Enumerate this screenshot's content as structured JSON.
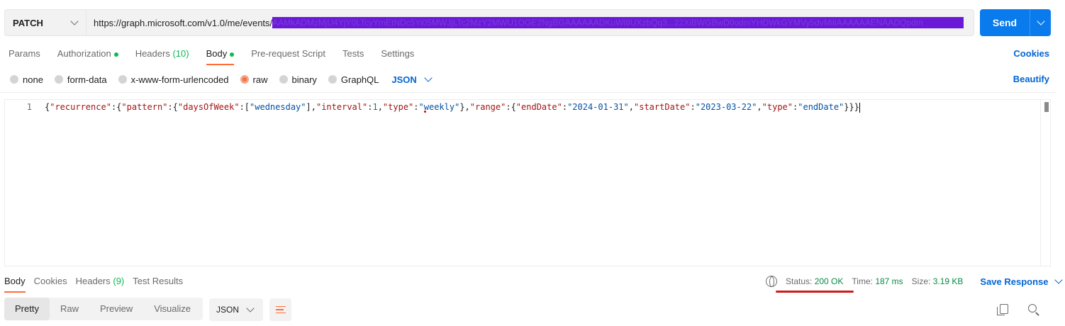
{
  "request": {
    "method": "PATCH",
    "url_base": "https://graph.microsoft.com/v1.0/me/events/",
    "url_redacted": "AAMkADMzMjU4YjY0LTcyYmEtNDc5Yi05MWJjLTc2MzY2MWU1OGE2NgBGAAAAAADKuWl8UXzbQq3...22XiBWGBwD0odmYHDWkGYMVy5dvMiliAAAAAAENAADQpdm",
    "send_label": "Send"
  },
  "request_tabs": {
    "params": "Params",
    "authorization": "Authorization",
    "headers_label": "Headers",
    "headers_count": "(10)",
    "body": "Body",
    "prerequest": "Pre-request Script",
    "tests": "Tests",
    "settings": "Settings",
    "cookies": "Cookies"
  },
  "body_types": {
    "none": "none",
    "form_data": "form-data",
    "urlencoded": "x-www-form-urlencoded",
    "raw": "raw",
    "binary": "binary",
    "graphql": "GraphQL",
    "format": "JSON",
    "beautify": "Beautify"
  },
  "editor": {
    "line_number": "1",
    "tokens": {
      "t1": "{",
      "t2": "\"recurrence\"",
      "t3": ":{",
      "t4": "\"pattern\"",
      "t5": ":{",
      "t6": "\"daysOfWeek\"",
      "t7": ":[",
      "t8": "\"wednesday\"",
      "t9": "],",
      "t10": "\"interval\"",
      "t11": ":",
      "t12": "1",
      "t13": ",",
      "t14": "\"type\"",
      "t15": ":",
      "t16": "\"weekly\"",
      "t17": "},",
      "t18": "\"range\"",
      "t19": ":{",
      "t20": "\"endDate\"",
      "t21": ":",
      "t22": "\"2024-01-31\"",
      "t23": ",",
      "t24": "\"startDate\"",
      "t25": ":",
      "t26": "\"2023-03-22\"",
      "t27": ",",
      "t28": "\"type\"",
      "t29": ":",
      "t30": "\"endDate\"",
      "t31": "}}}"
    }
  },
  "response_tabs": {
    "body": "Body",
    "cookies": "Cookies",
    "headers_label": "Headers",
    "headers_count": "(9)",
    "test_results": "Test Results"
  },
  "response_status": {
    "status_label": "Status:",
    "status_value": "200 OK",
    "time_label": "Time:",
    "time_value": "187 ms",
    "size_label": "Size:",
    "size_value": "3.19 KB",
    "save_response": "Save Response"
  },
  "response_view": {
    "pretty": "Pretty",
    "raw": "Raw",
    "preview": "Preview",
    "visualize": "Visualize",
    "format": "JSON"
  },
  "colors": {
    "accent_orange": "#ff6c37",
    "link_blue": "#0265d2",
    "send_blue": "#097bed",
    "success_green": "#0cbb52",
    "redaction_purple": "#6a1ad6",
    "annotation_red": "#d11b1b"
  },
  "icons": {
    "method_dropdown": "chevron-down-icon",
    "send_dropdown": "chevron-down-icon",
    "network": "globe-icon",
    "wrap": "wrap-lines-icon",
    "copy": "copy-icon",
    "search": "search-icon"
  }
}
